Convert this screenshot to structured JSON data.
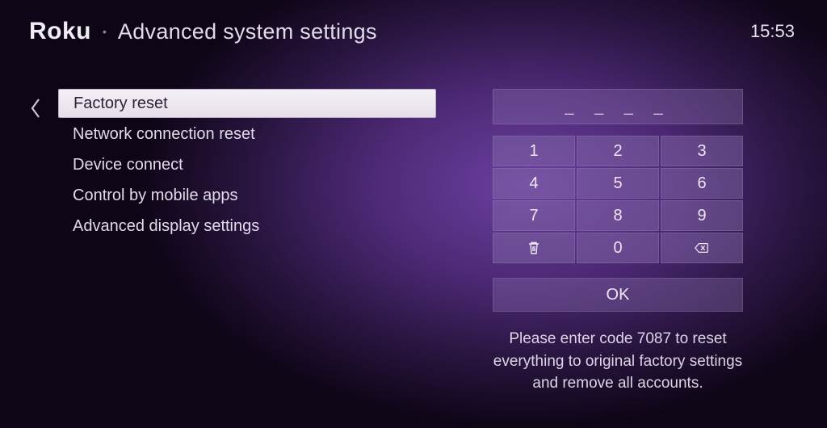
{
  "header": {
    "logo": "Roku",
    "page_title": "Advanced system settings",
    "clock": "15:53"
  },
  "menu": {
    "items": [
      {
        "label": "Factory reset",
        "selected": true
      },
      {
        "label": "Network connection reset",
        "selected": false
      },
      {
        "label": "Device connect",
        "selected": false
      },
      {
        "label": "Control by mobile apps",
        "selected": false
      },
      {
        "label": "Advanced display settings",
        "selected": false
      }
    ]
  },
  "pin": {
    "display_value": "_ _ _ _",
    "keys": [
      "1",
      "2",
      "3",
      "4",
      "5",
      "6",
      "7",
      "8",
      "9"
    ],
    "key_zero": "0",
    "ok_label": "OK",
    "instruction": "Please enter code 7087 to reset everything to original factory settings and remove all accounts."
  }
}
